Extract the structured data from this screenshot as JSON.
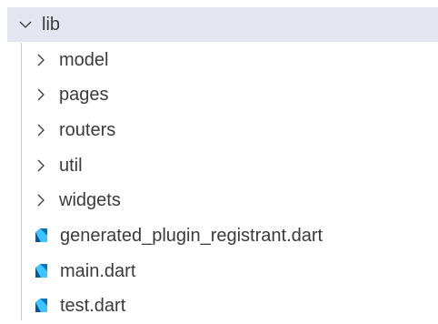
{
  "explorer": {
    "root": {
      "label": "lib",
      "expanded": true,
      "icon": "chevron-down-icon"
    },
    "folders": [
      {
        "label": "model",
        "icon": "chevron-right-icon"
      },
      {
        "label": "pages",
        "icon": "chevron-right-icon"
      },
      {
        "label": "routers",
        "icon": "chevron-right-icon"
      },
      {
        "label": "util",
        "icon": "chevron-right-icon"
      },
      {
        "label": "widgets",
        "icon": "chevron-right-icon"
      }
    ],
    "files": [
      {
        "label": "generated_plugin_registrant.dart",
        "icon": "dart-file-icon"
      },
      {
        "label": "main.dart",
        "icon": "dart-file-icon"
      },
      {
        "label": "test.dart",
        "icon": "dart-file-icon"
      }
    ]
  },
  "colors": {
    "selected_background": "#e4e6f1",
    "text": "#3b3b3b",
    "dart_dark": "#01579b",
    "dart_light": "#40c4ff"
  }
}
